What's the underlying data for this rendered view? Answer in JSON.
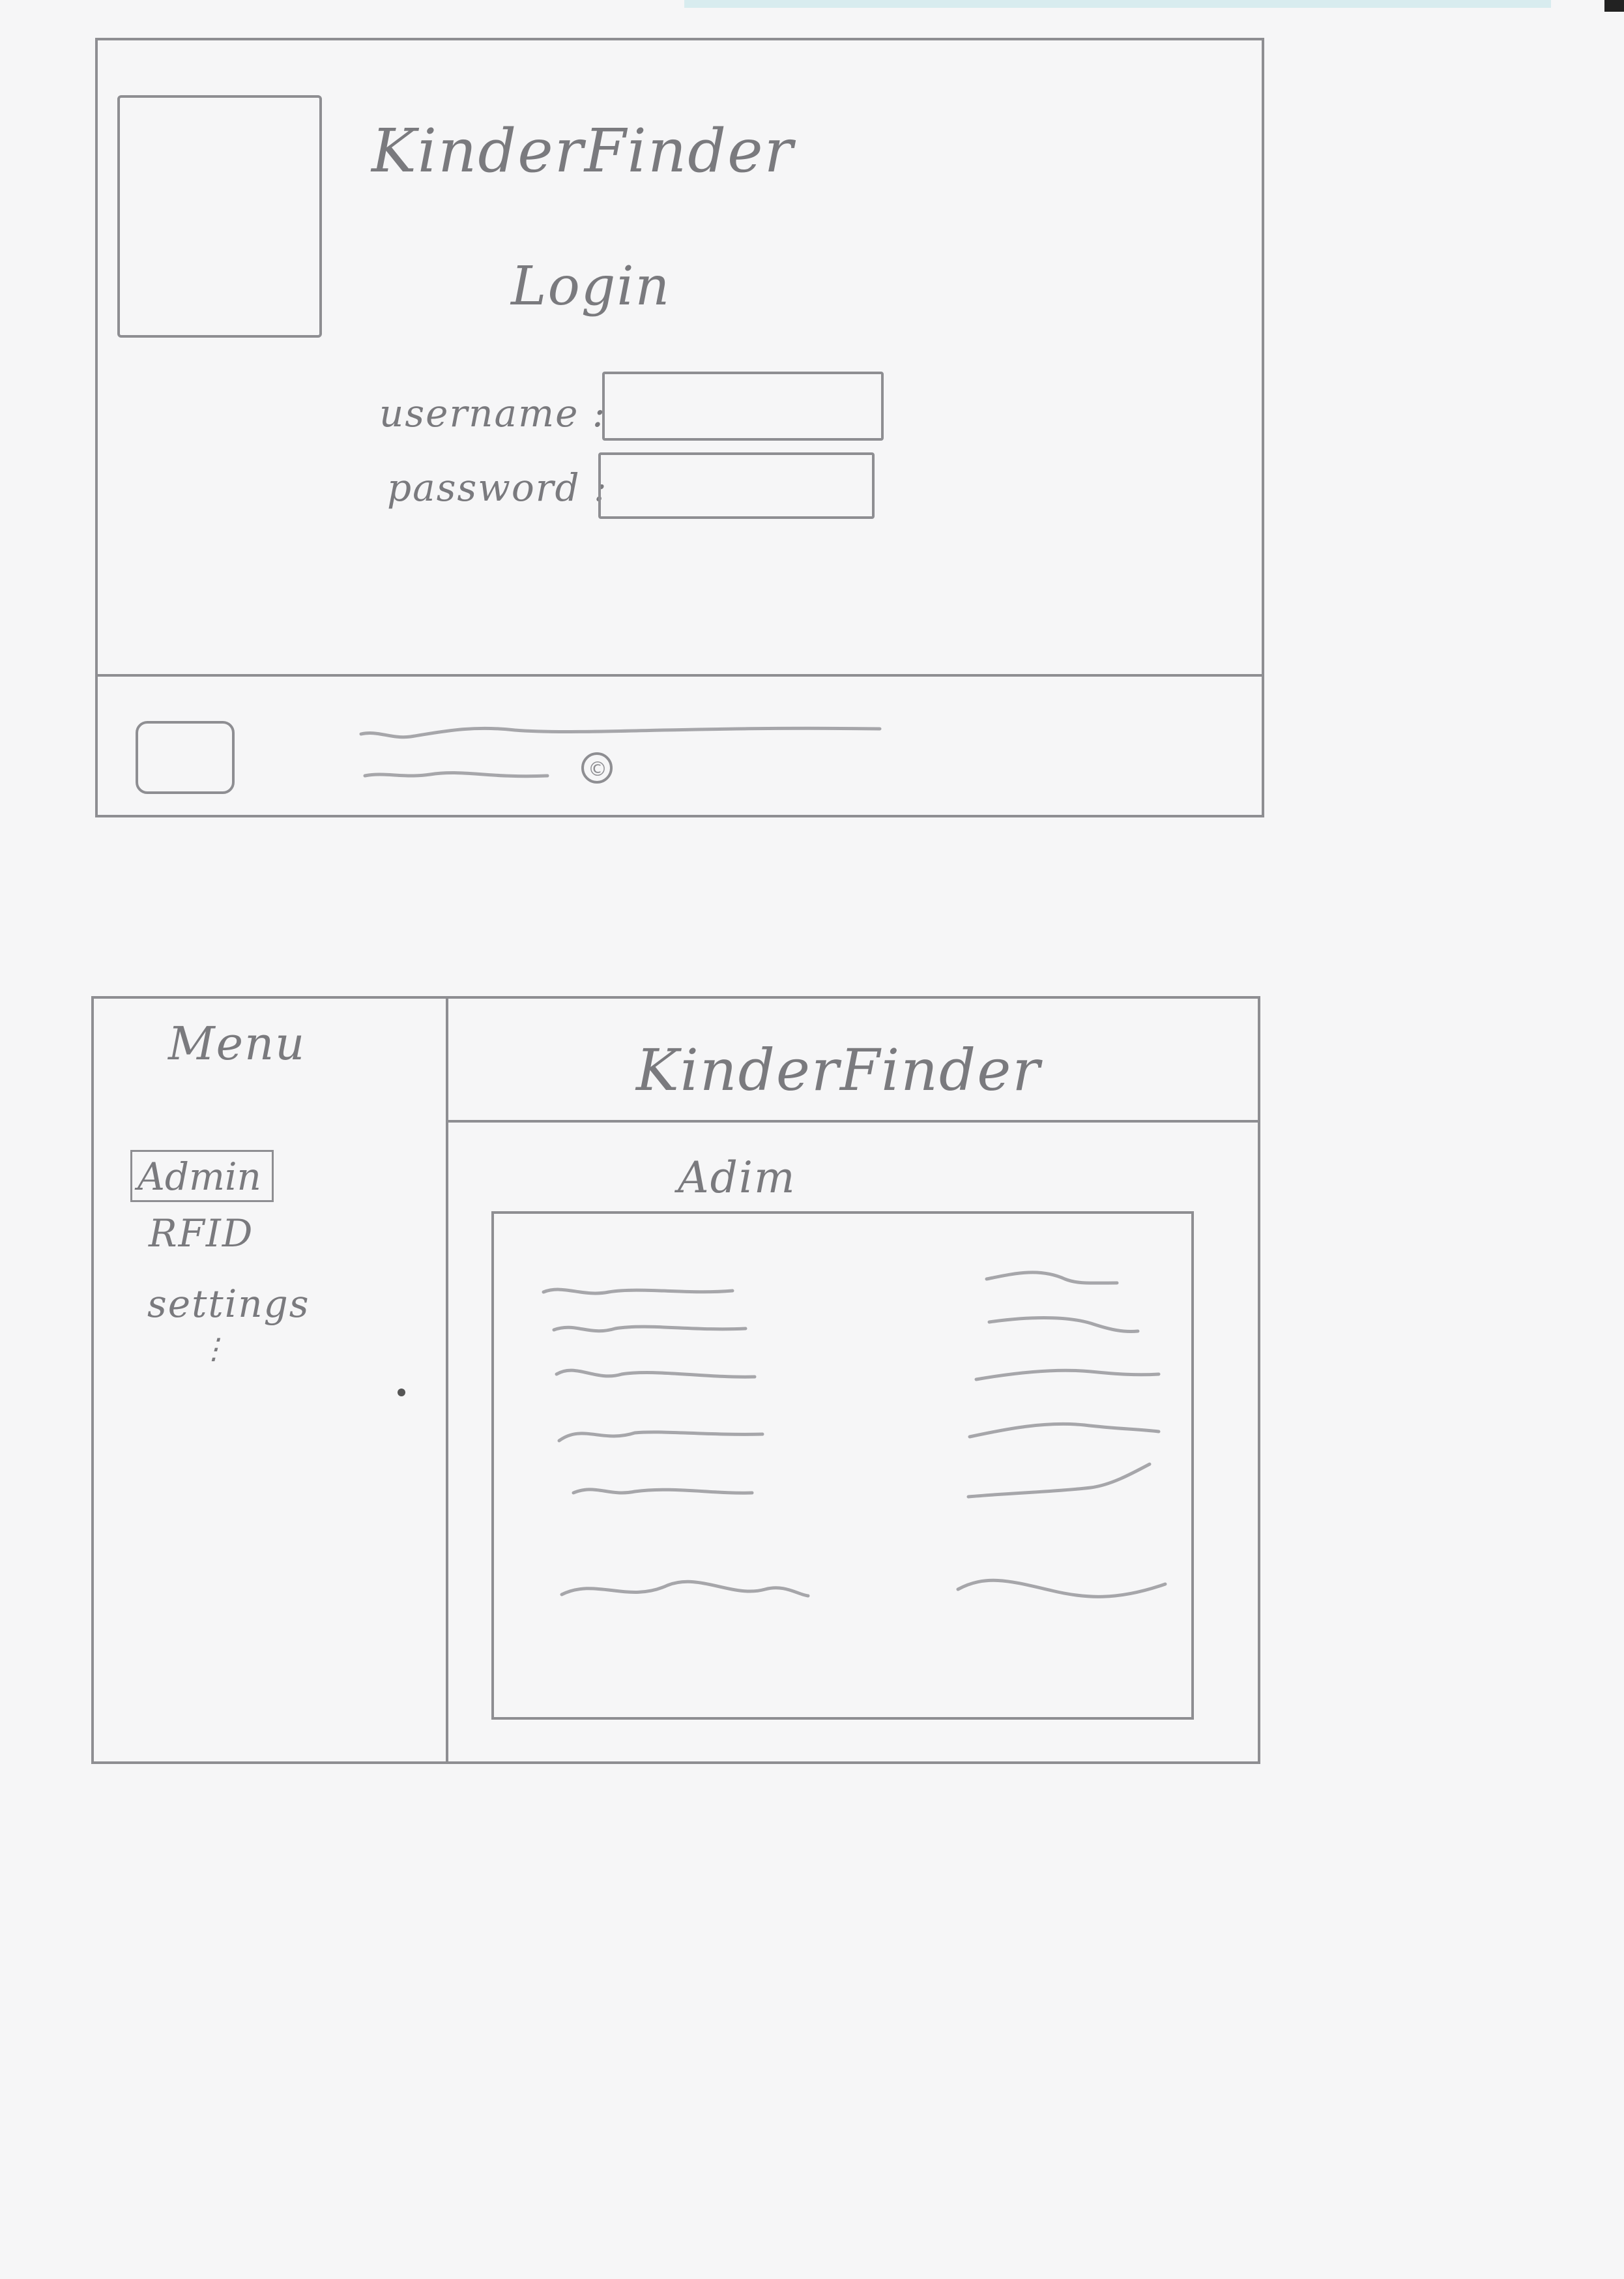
{
  "login_screen": {
    "app_title": "KinderFinder",
    "heading": "Login",
    "username_label": "username :",
    "password_label": "password :",
    "username_value": "",
    "password_value": "",
    "copyright_symbol": "©"
  },
  "admin_screen": {
    "menu_heading": "Menu",
    "menu_items": [
      "Admin",
      "RFID",
      "settings"
    ],
    "menu_more": "⋮",
    "selected_item": "Admin",
    "app_title": "KinderFinder",
    "section_heading": "Adim"
  },
  "colors": {
    "paper": "#f6f6f7",
    "pencil": "#8e8e92"
  }
}
